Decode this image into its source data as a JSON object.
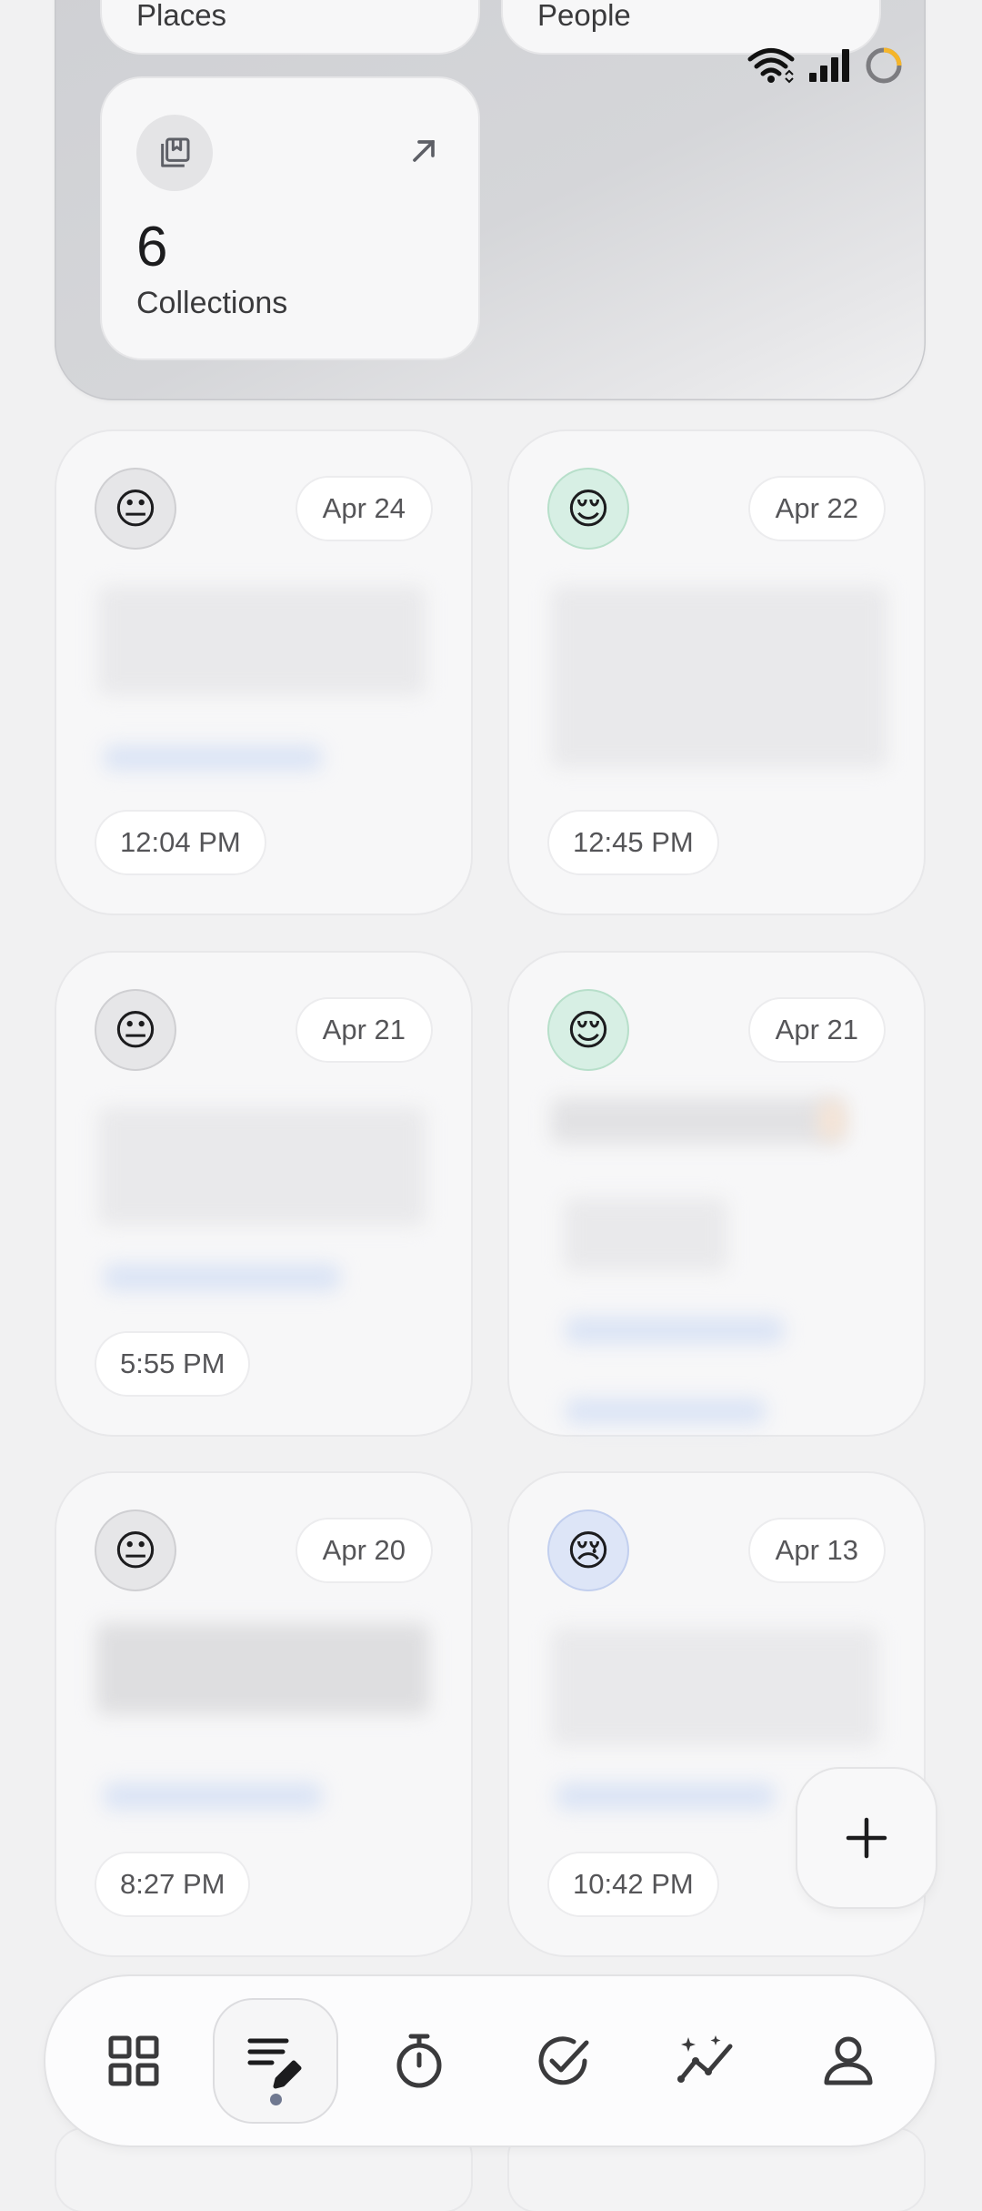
{
  "summary": {
    "places_label": "Places",
    "people_label": "People",
    "collections": {
      "count": "6",
      "label": "Collections"
    }
  },
  "entries": [
    {
      "mood": "neutral",
      "emoji": "😐",
      "date": "Apr 24",
      "time": "12:04 PM"
    },
    {
      "mood": "relieved",
      "emoji": "😌",
      "date": "Apr 22",
      "time": "12:45 PM"
    },
    {
      "mood": "neutral",
      "emoji": "😐",
      "date": "Apr 21",
      "time": "5:55 PM"
    },
    {
      "mood": "relieved",
      "emoji": "😌",
      "date": "Apr 21",
      "time": ""
    },
    {
      "mood": "neutral",
      "emoji": "😐",
      "date": "Apr 20",
      "time": "8:27 PM"
    },
    {
      "mood": "sad",
      "emoji": "😢",
      "date": "Apr 13",
      "time": "10:42 PM"
    }
  ],
  "fab": {
    "icon": "plus-icon"
  },
  "nav": {
    "items": [
      {
        "name": "grid",
        "icon": "grid-icon"
      },
      {
        "name": "journal",
        "icon": "journal-edit-icon",
        "active": true
      },
      {
        "name": "timer",
        "icon": "timer-icon"
      },
      {
        "name": "tasks",
        "icon": "check-circle-icon"
      },
      {
        "name": "insights",
        "icon": "sparkle-chart-icon"
      },
      {
        "name": "profile",
        "icon": "person-icon"
      }
    ]
  },
  "status_bar": {
    "icons": [
      "wifi-icon",
      "signal-icon",
      "battery-ring-icon"
    ]
  },
  "colors": {
    "mood_neutral_bg": "#e6e6e8",
    "mood_relieved_bg": "#d7efe4",
    "mood_sad_bg": "#dde5f7",
    "accent_dot": "#6f7890"
  }
}
